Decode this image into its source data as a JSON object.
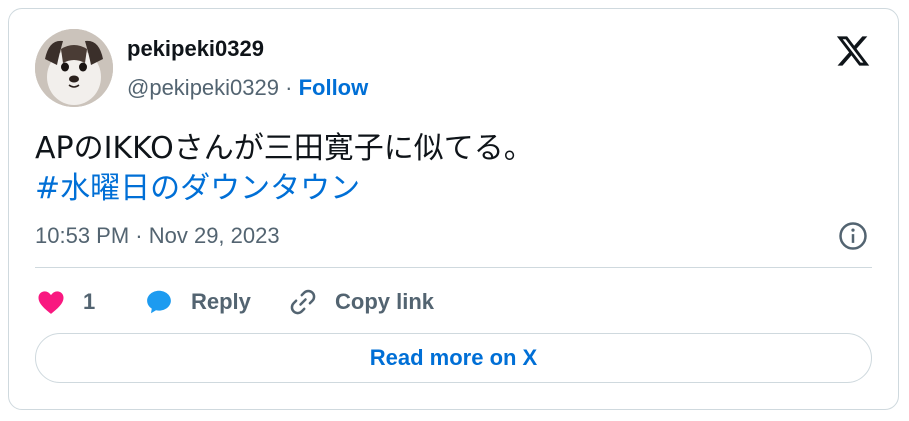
{
  "author": {
    "display_name": "pekipeki0329",
    "handle": "@pekipeki0329",
    "separator": "·",
    "follow_label": "Follow"
  },
  "tweet": {
    "text_line": "APのIKKOさんが三田寛子に似てる。",
    "hashtag": "#水曜日のダウンタウン",
    "timestamp": "10:53 PM · Nov 29, 2023"
  },
  "actions": {
    "like_count": "1",
    "reply_label": "Reply",
    "copy_link_label": "Copy link"
  },
  "read_more_label": "Read more on X",
  "colors": {
    "accent": "#006fd6",
    "like": "#f91880",
    "text": "#0f1419",
    "muted": "#536471",
    "border": "#cfd9de"
  },
  "icons": {
    "logo": "x-logo-icon",
    "info": "info-icon",
    "like": "heart-icon",
    "reply": "speech-bubble-icon",
    "copy": "link-icon"
  }
}
